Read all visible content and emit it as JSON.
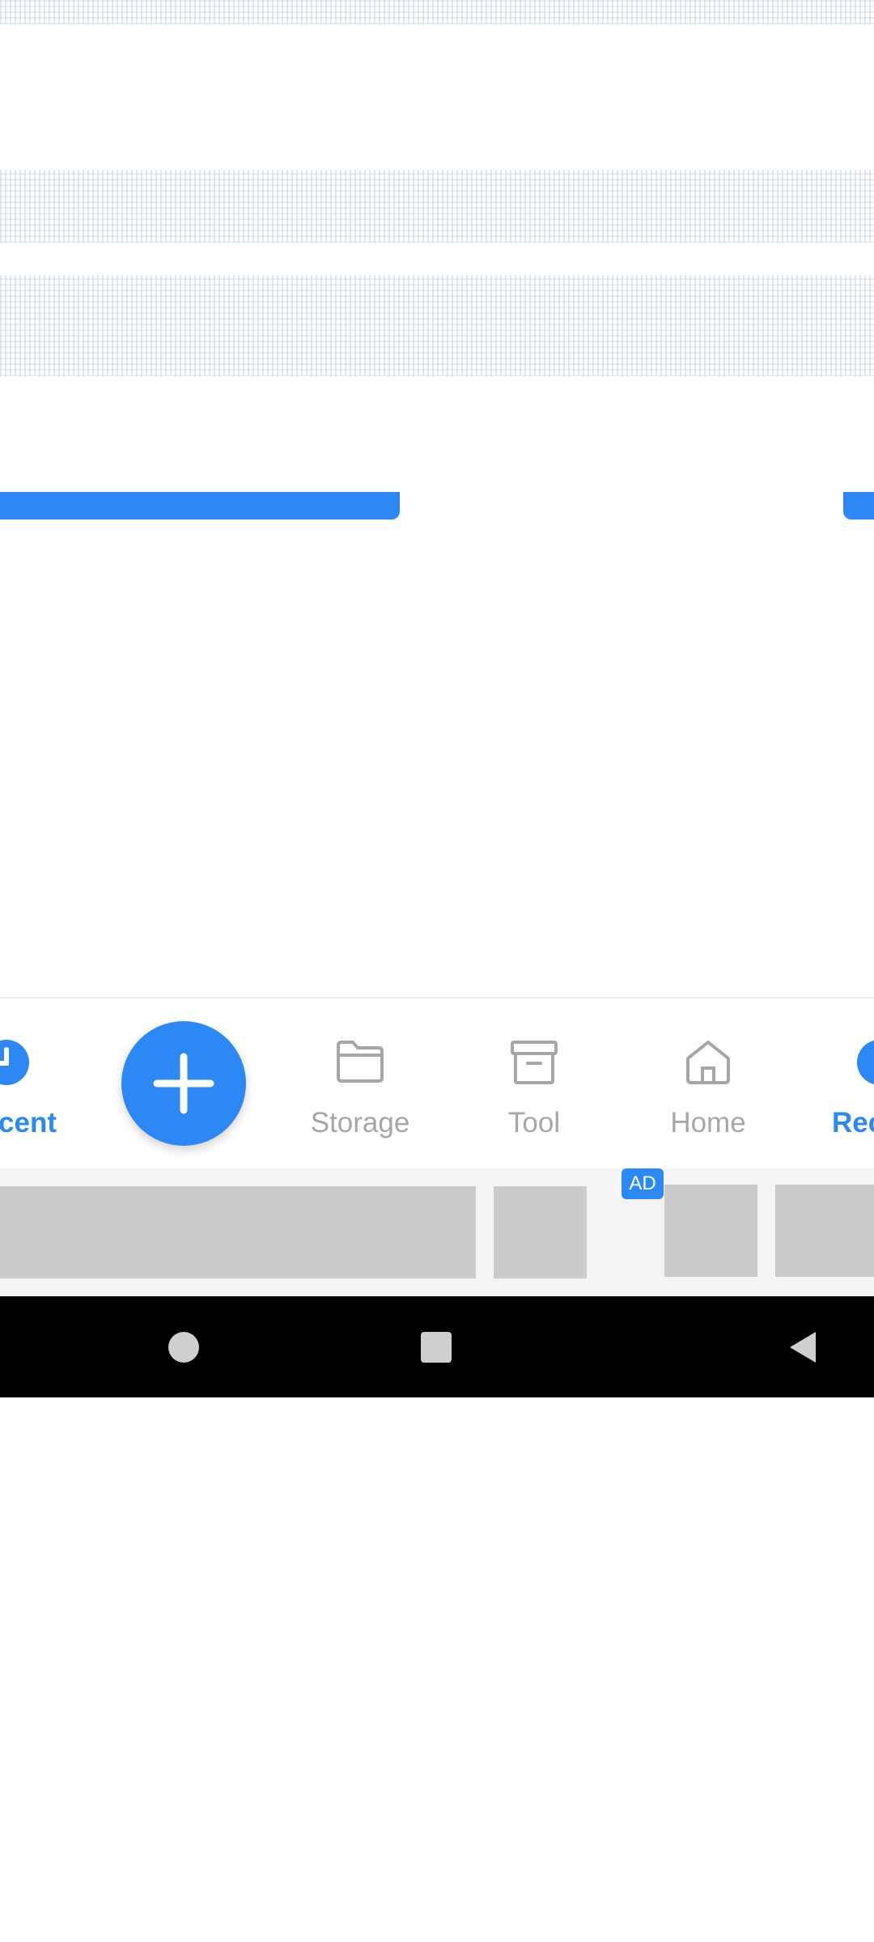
{
  "bottom_nav": {
    "items": [
      {
        "label": "cent",
        "state": "active",
        "icon": "clock-icon"
      },
      {
        "label": "Storage",
        "state": "inactive",
        "icon": "folder-icon"
      },
      {
        "label": "Tool",
        "state": "inactive",
        "icon": "archive-box-icon"
      },
      {
        "label": "Home",
        "state": "inactive",
        "icon": "home-icon"
      },
      {
        "label": "Rec",
        "state": "active",
        "icon": "clock-icon"
      }
    ],
    "fab_icon": "plus-icon"
  },
  "ad": {
    "badge": "AD"
  },
  "system_nav": {
    "buttons": [
      "home-circle",
      "recents-square",
      "back-triangle"
    ]
  },
  "colors": {
    "accent": "#2b88f5",
    "inactive": "#a6a6a6",
    "ad_placeholder": "#cbcbcb",
    "system_bar": "#000000"
  }
}
